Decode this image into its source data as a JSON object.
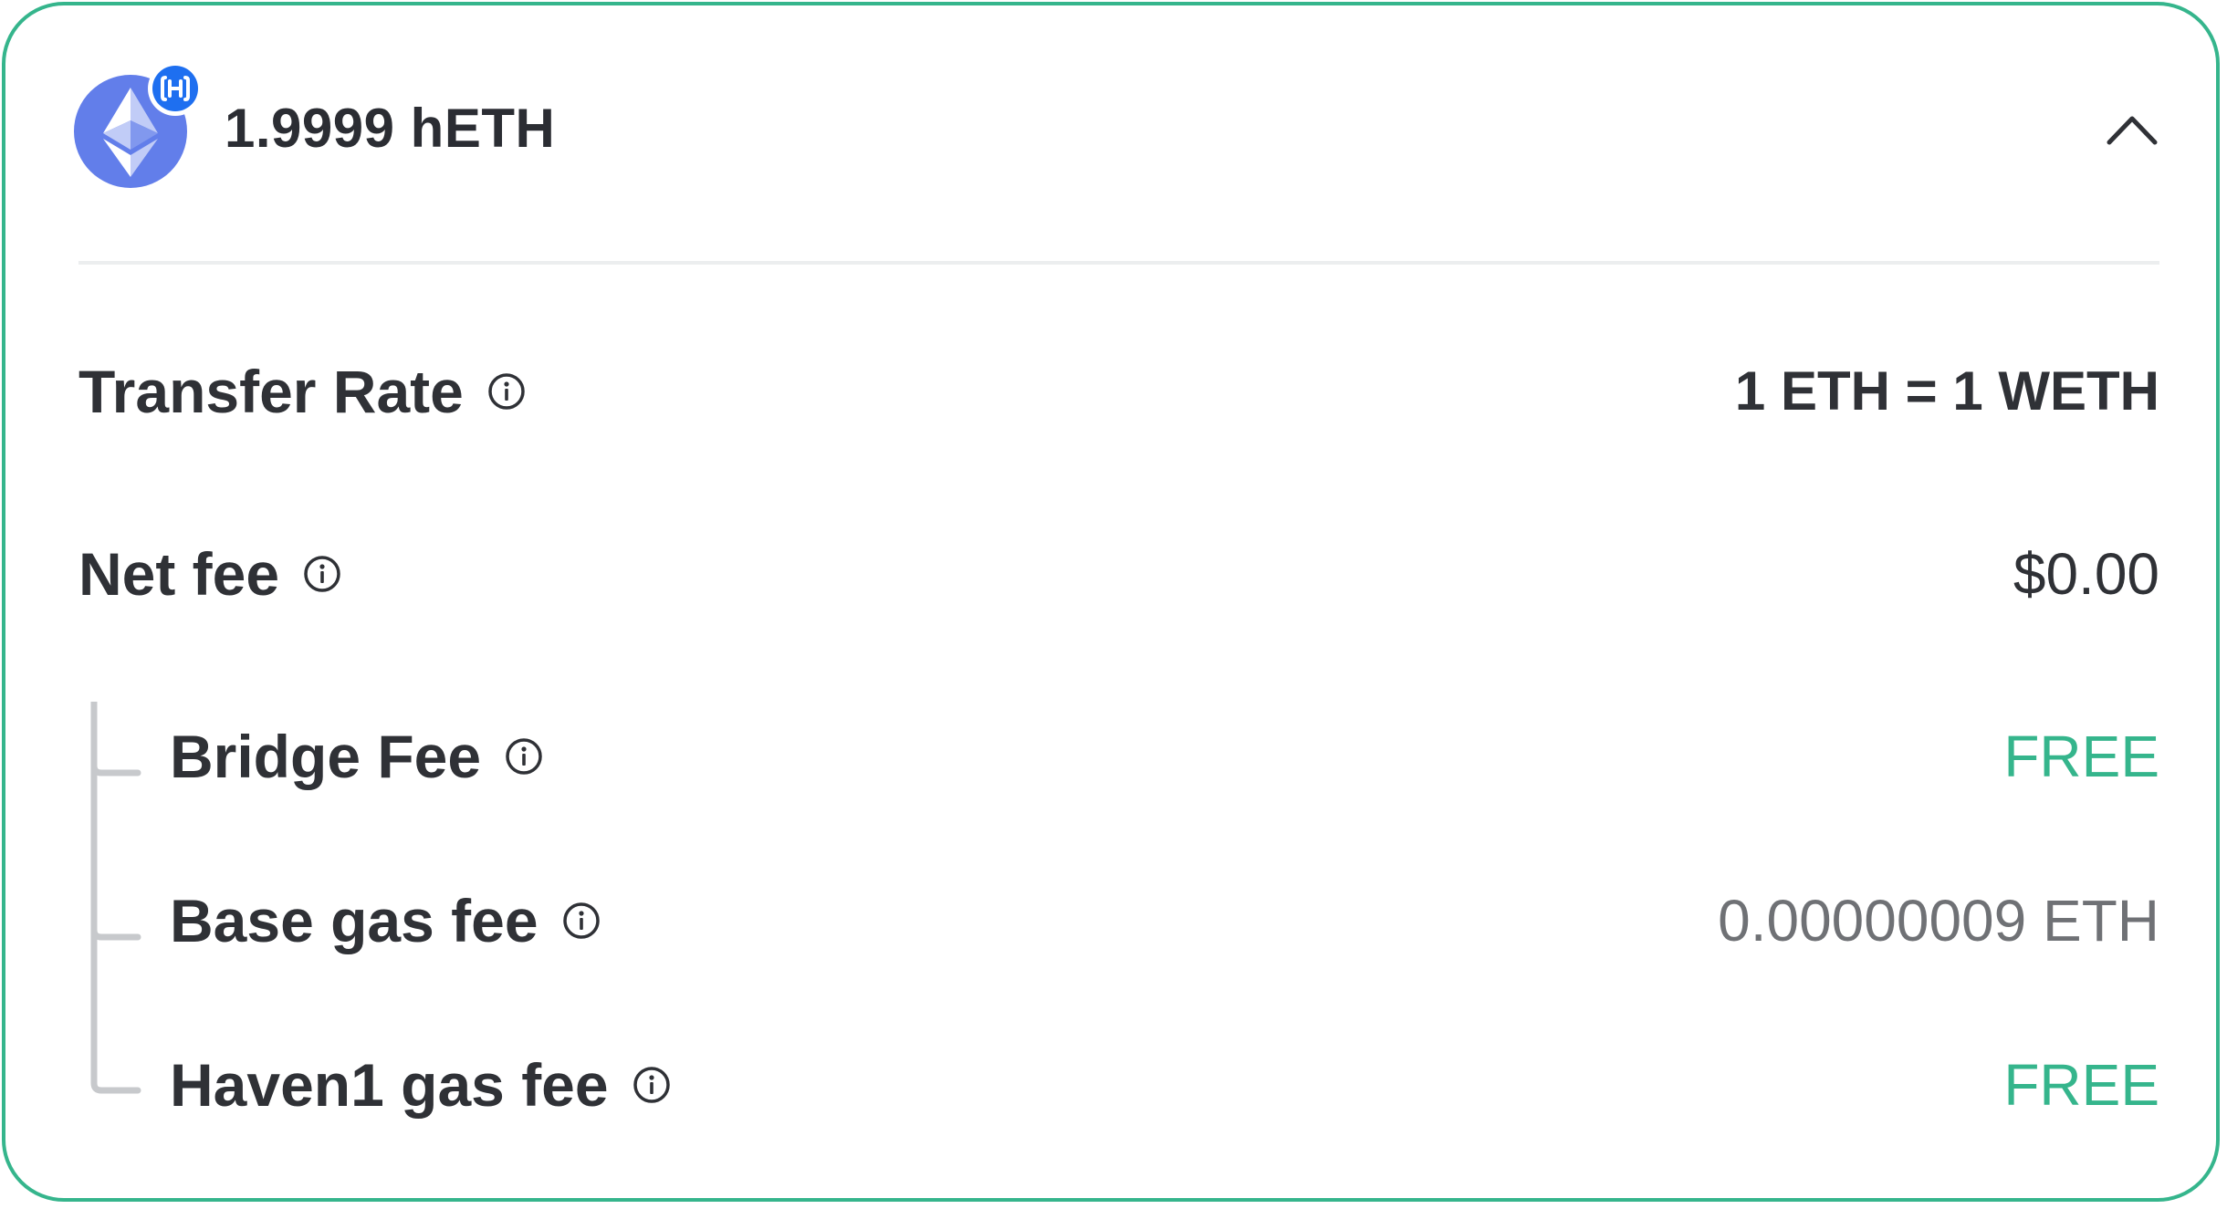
{
  "header": {
    "balance": "1.9999 hETH",
    "token_icon": "ethereum-icon",
    "badge_icon": "haven1-badge-icon",
    "collapse_icon": "chevron-up-icon"
  },
  "rows": {
    "transfer_rate": {
      "label": "Transfer Rate",
      "value": "1 ETH = 1 WETH"
    },
    "net_fee": {
      "label": "Net fee",
      "value": "$0.00"
    },
    "bridge_fee": {
      "label": "Bridge Fee",
      "value": "FREE"
    },
    "base_gas_fee": {
      "label": "Base gas fee",
      "value": "0.00000009 ETH"
    },
    "haven1_gas_fee": {
      "label": "Haven1 gas fee",
      "value": "FREE"
    }
  },
  "colors": {
    "accent": "#35b58c",
    "text": "#2f3136",
    "muted": "#6f7175",
    "eth_blue": "#627eea",
    "badge_blue": "#1e6ff0"
  }
}
